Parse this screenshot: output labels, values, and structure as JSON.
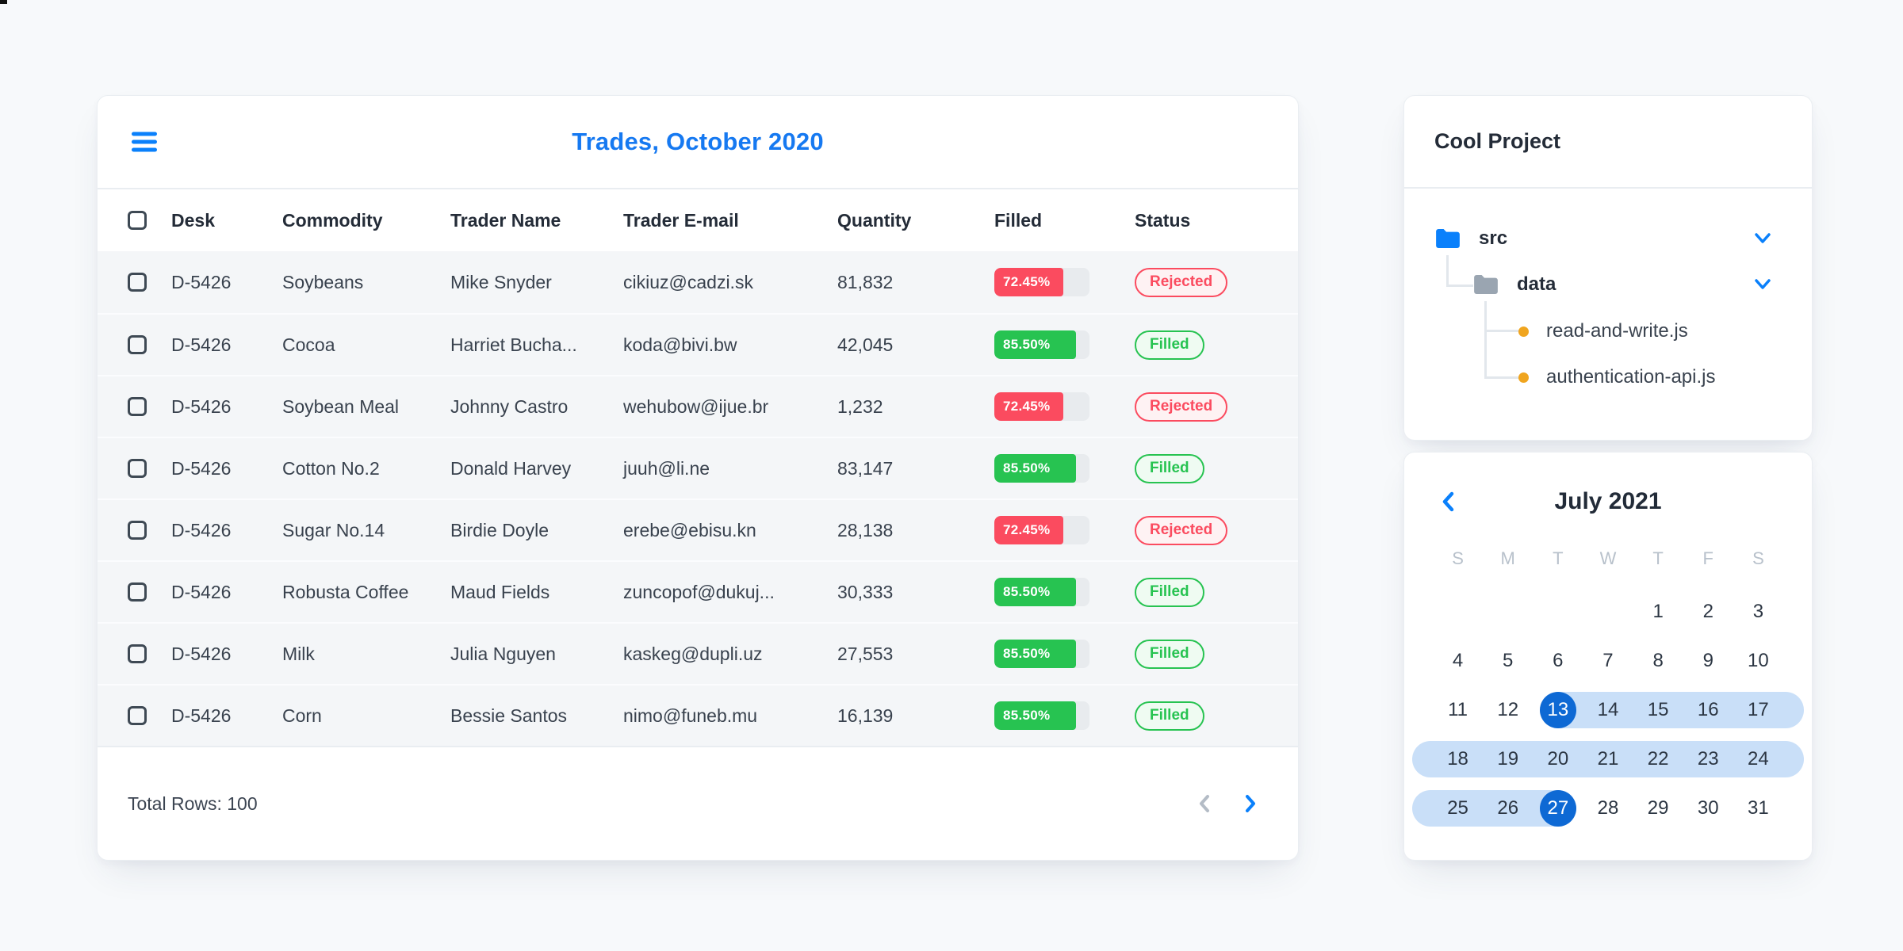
{
  "colors": {
    "accent_blue": "#0a80fb",
    "title_blue": "#1679f1",
    "selected_day_blue": "#0e69d4",
    "range_blue": "#c9dff8",
    "rejected_red": "#fb4b5f",
    "filled_green": "#27c351",
    "progress_track_gray": "#e8ebee",
    "file_dot_orange": "#f0a51f",
    "folder_gray": "#9aa5b1",
    "row_bg": "#f4f6f8"
  },
  "trades_card": {
    "menu_icon": "hamburger-icon",
    "title": "Trades, October 2020",
    "columns": [
      "Desk",
      "Commodity",
      "Trader Name",
      "Trader E-mail",
      "Quantity",
      "Filled",
      "Status"
    ],
    "rows": [
      {
        "desk": "D-5426",
        "commodity": "Soybeans",
        "trader": "Mike Snyder",
        "email": "cikiuz@cadzi.sk",
        "quantity": "81,832",
        "filled_pct": "72.45%",
        "status": "Rejected"
      },
      {
        "desk": "D-5426",
        "commodity": "Cocoa",
        "trader": "Harriet Bucha...",
        "email": "koda@bivi.bw",
        "quantity": "42,045",
        "filled_pct": "85.50%",
        "status": "Filled"
      },
      {
        "desk": "D-5426",
        "commodity": "Soybean Meal",
        "trader": "Johnny Castro",
        "email": "wehubow@ijue.br",
        "quantity": "1,232",
        "filled_pct": "72.45%",
        "status": "Rejected"
      },
      {
        "desk": "D-5426",
        "commodity": "Cotton No.2",
        "trader": "Donald Harvey",
        "email": "juuh@li.ne",
        "quantity": "83,147",
        "filled_pct": "85.50%",
        "status": "Filled"
      },
      {
        "desk": "D-5426",
        "commodity": "Sugar No.14",
        "trader": "Birdie Doyle",
        "email": "erebe@ebisu.kn",
        "quantity": "28,138",
        "filled_pct": "72.45%",
        "status": "Rejected"
      },
      {
        "desk": "D-5426",
        "commodity": "Robusta Coffee",
        "trader": "Maud Fields",
        "email": "zuncopof@dukuj...",
        "quantity": "30,333",
        "filled_pct": "85.50%",
        "status": "Filled"
      },
      {
        "desk": "D-5426",
        "commodity": "Milk",
        "trader": "Julia Nguyen",
        "email": "kaskeg@dupli.uz",
        "quantity": "27,553",
        "filled_pct": "85.50%",
        "status": "Filled"
      },
      {
        "desk": "D-5426",
        "commodity": "Corn",
        "trader": "Bessie Santos",
        "email": "nimo@funeb.mu",
        "quantity": "16,139",
        "filled_pct": "85.50%",
        "status": "Filled"
      }
    ],
    "footer": {
      "total_label": "Total Rows: 100",
      "prev_icon": "chevron-left-icon",
      "next_icon": "chevron-right-icon"
    }
  },
  "project_card": {
    "title": "Cool Project",
    "tree": [
      {
        "label": "src",
        "type": "folder",
        "icon": "folder-icon",
        "expanded": true
      },
      {
        "label": "data",
        "type": "folder",
        "icon": "folder-icon",
        "expanded": true
      },
      {
        "label": "read-and-write.js",
        "type": "file",
        "icon": "file-dot-icon"
      },
      {
        "label": "authentication-api.js",
        "type": "file",
        "icon": "file-dot-icon"
      }
    ]
  },
  "calendar_card": {
    "title": "July 2021",
    "prev_icon": "chevron-left-icon",
    "weekdays": [
      "S",
      "M",
      "T",
      "W",
      "T",
      "F",
      "S"
    ],
    "weeks": [
      [
        "",
        "",
        "",
        "",
        "1",
        "2",
        "3"
      ],
      [
        "4",
        "5",
        "6",
        "7",
        "8",
        "9",
        "10"
      ],
      [
        "11",
        "12",
        "13",
        "14",
        "15",
        "16",
        "17"
      ],
      [
        "18",
        "19",
        "20",
        "21",
        "22",
        "23",
        "24"
      ],
      [
        "25",
        "26",
        "27",
        "28",
        "29",
        "30",
        "31"
      ]
    ],
    "selected_start": "13",
    "selected_end": "27"
  }
}
